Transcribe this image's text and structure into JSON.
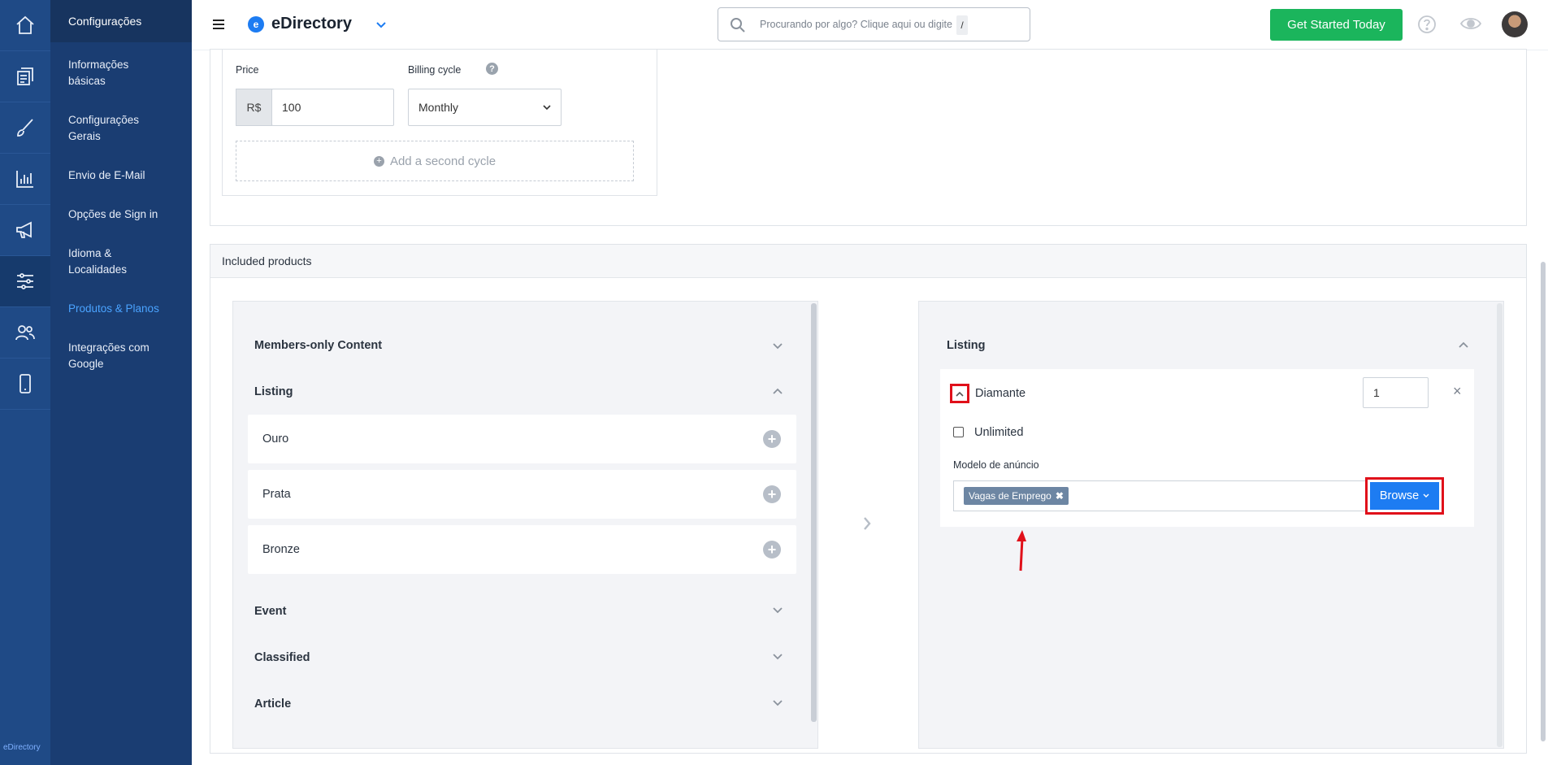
{
  "iconbar": {
    "items": [
      {
        "icon": "home-icon"
      },
      {
        "icon": "content-icon"
      },
      {
        "icon": "design-brush-icon"
      },
      {
        "icon": "reports-chart-icon"
      },
      {
        "icon": "promotion-megaphone-icon"
      },
      {
        "icon": "settings-sliders-icon"
      },
      {
        "icon": "users-icon"
      },
      {
        "icon": "mobile-icon"
      }
    ],
    "brand": "eDirectory"
  },
  "sidebar": {
    "title": "Configurações",
    "items": [
      {
        "label1": "Informações",
        "label2": "básicas"
      },
      {
        "label1": "Configurações",
        "label2": "Gerais"
      },
      {
        "label1": "Envio de E-Mail",
        "label2": ""
      },
      {
        "label1": "Opções de Sign in",
        "label2": ""
      },
      {
        "label1": "Idioma &",
        "label2": "Localidades"
      },
      {
        "label1": "Produtos & Planos",
        "label2": ""
      },
      {
        "label1": "Integrações com",
        "label2": "Google"
      }
    ]
  },
  "topbar": {
    "app_name": "eDirectory",
    "search_placeholder": "Procurando por algo? Clique aqui ou digite",
    "search_shortcut": "/",
    "cta_label": "Get Started Today",
    "accent": "#1bb55c"
  },
  "pricing": {
    "price_label": "Price",
    "currency": "R$",
    "price_value": "100",
    "billing_label": "Billing cycle",
    "billing_value": "Monthly",
    "add_cycle": "Add a second cycle"
  },
  "included": {
    "title": "Included products",
    "left": {
      "sections": [
        {
          "label": "Members-only Content",
          "expanded": false
        },
        {
          "label": "Listing",
          "expanded": true
        },
        {
          "label": "Event",
          "expanded": false
        },
        {
          "label": "Classified",
          "expanded": false
        },
        {
          "label": "Article",
          "expanded": false
        }
      ],
      "listing_levels": [
        "Ouro",
        "Prata",
        "Bronze"
      ]
    },
    "right": {
      "section": "Listing",
      "item": {
        "name": "Diamante",
        "quantity": "1",
        "unlimited_label": "Unlimited",
        "unlimited_checked": false,
        "template_label": "Modelo de anúncio",
        "template_tag": "Vagas de Emprego",
        "browse_label": "Browse"
      }
    }
  },
  "colors": {
    "primary_blue": "#1d7cf2",
    "highlight_red": "#e0101a",
    "nav_dark": "#1a3d72"
  }
}
